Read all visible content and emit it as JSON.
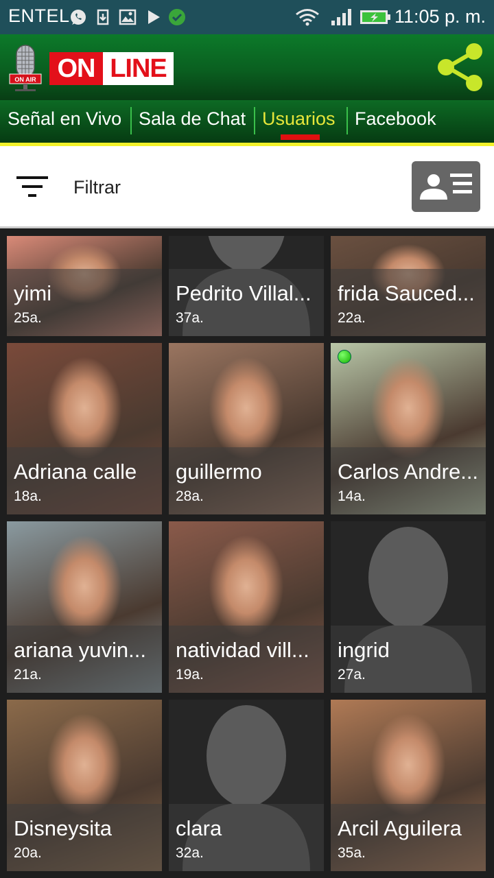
{
  "status_bar": {
    "carrier": "ENTEL",
    "time": "11:05 p. m."
  },
  "app": {
    "logo_on": "ON",
    "logo_line": "LINE",
    "mic_badge": "ON AIR"
  },
  "tabs": [
    {
      "label": "Señal en Vivo",
      "active": false
    },
    {
      "label": "Sala de Chat",
      "active": false
    },
    {
      "label": "Usuarios",
      "active": true
    },
    {
      "label": "Facebook",
      "active": false
    }
  ],
  "filter": {
    "label": "Filtrar"
  },
  "users": [
    {
      "name": "yimi",
      "age": "25a.",
      "photo": "photo",
      "online": false,
      "tint": "#d98a78"
    },
    {
      "name": "Pedrito Villal...",
      "age": "37a.",
      "photo": "placeholder",
      "online": false,
      "tint": "#3a3a3a"
    },
    {
      "name": "frida Sauced...",
      "age": "22a.",
      "photo": "photo",
      "online": false,
      "tint": "#6a5040"
    },
    {
      "name": "Adriana calle",
      "age": "18a.",
      "photo": "photo",
      "online": false,
      "tint": "#7a4a3a"
    },
    {
      "name": "guillermo",
      "age": "28a.",
      "photo": "photo",
      "online": false,
      "tint": "#9a7560"
    },
    {
      "name": "Carlos Andre...",
      "age": "14a.",
      "photo": "photo",
      "online": true,
      "tint": "#b9c7a8"
    },
    {
      "name": "ariana yuvin...",
      "age": "21a.",
      "photo": "photo",
      "online": false,
      "tint": "#8a9aa0"
    },
    {
      "name": "natividad vill...",
      "age": "19a.",
      "photo": "photo",
      "online": false,
      "tint": "#8a5a4a"
    },
    {
      "name": "ingrid",
      "age": "27a.",
      "photo": "placeholder",
      "online": false,
      "tint": "#3a3a3a"
    },
    {
      "name": "Disneysita",
      "age": "20a.",
      "photo": "photo",
      "online": false,
      "tint": "#8b6a4a"
    },
    {
      "name": "clara",
      "age": "32a.",
      "photo": "placeholder",
      "online": false,
      "tint": "#3a3a3a"
    },
    {
      "name": "Arcil Aguilera",
      "age": "35a.",
      "photo": "photo",
      "online": false,
      "tint": "#b07a55"
    }
  ],
  "colors": {
    "status_bar": "#1f4f5a",
    "header_green": "#0c7a2a",
    "tab_active": "#e6e63a",
    "tab_indicator": "#e01010",
    "tab_underline": "#f2f22a",
    "share_icon": "#c8e62a",
    "online_dot": "#15b000"
  },
  "icons": {
    "status": [
      "whatsapp-icon",
      "download-icon",
      "image-icon",
      "play-icon",
      "check-circle-icon",
      "wifi-icon",
      "signal-icon",
      "battery-icon"
    ],
    "header": [
      "microphone-icon",
      "share-icon"
    ],
    "filter": [
      "filter-icon",
      "contact-card-icon"
    ]
  }
}
